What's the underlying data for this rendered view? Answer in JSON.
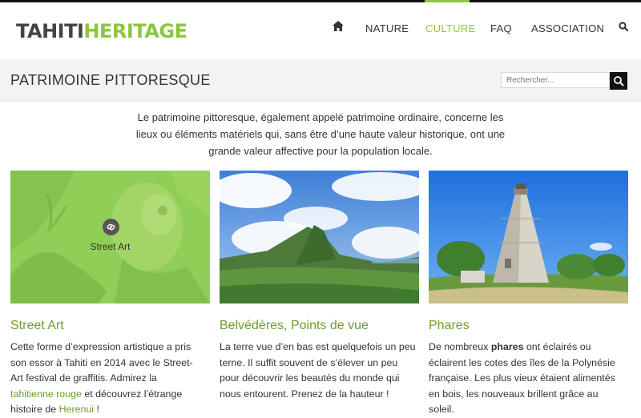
{
  "logo": {
    "part1": "TAHITI",
    "part2": "HERITAGE"
  },
  "nav": {
    "home_icon": "home-icon",
    "items": [
      {
        "label": "NATURE"
      },
      {
        "label": "CULTURE",
        "active": true
      },
      {
        "label": "FAQ"
      },
      {
        "label": "ASSOCIATION"
      }
    ],
    "search_icon": "search-icon"
  },
  "page": {
    "title": "PATRIMOINE PITTORESQUE",
    "search_placeholder": "Rechercher..."
  },
  "intro": {
    "line1": "Le patrimoine pittoresque, également appelé patrimoine ordinaire, concerne les",
    "line2": "lieux ou éléments matériels qui, sans être d’une haute valeur historique, ont une",
    "line3": "grande valeur affective pour la population locale."
  },
  "cards": [
    {
      "title": "Street Art",
      "overlay_label": "Street Art",
      "overlay_icon": "link-icon",
      "lines": [
        "Cette forme d’expression artistique a pris",
        "son essor à Tahiti en 2014 avec le Street-",
        "Art festival de graffitis. Admirez la"
      ],
      "line4_link": "tahitienne rouge",
      "line4_rest": " et découvrez l’étrange",
      "line5_pre": "histoire de ",
      "line5_link": "Herenui",
      "line5_post": " !"
    },
    {
      "title": "Belvédères, Points de vue",
      "lines": [
        "La terre vue d’en bas est quelquefois un peu",
        "terne. Il suffit souvent de s’élever un peu",
        "pour découvrir les beautés du monde qui",
        "nous entourent. Prenez de la hauteur !"
      ]
    },
    {
      "title": "Phares",
      "line1_pre": "De nombreux ",
      "line1_bold": "phares",
      "line1_post": " ont éclairés ou",
      "lines": [
        "éclairent les cotes des îles de la Polynésie",
        "française. Les plus vieux étaient alimentés",
        "en bois, les nouveaux brillent grâce au",
        "soleil."
      ]
    }
  ],
  "colors": {
    "accent": "#8cc63f",
    "link": "#6f9c2a",
    "dark": "#111111"
  }
}
